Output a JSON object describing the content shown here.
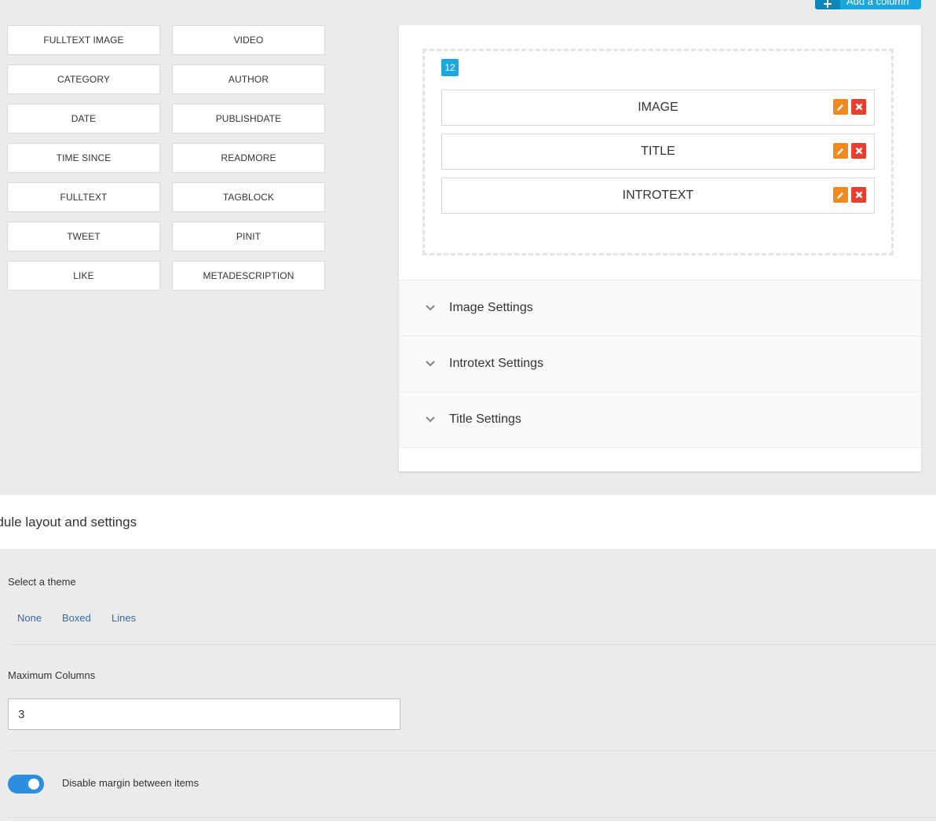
{
  "top": {
    "add_column_label": "Add a column"
  },
  "fields": [
    [
      "FULLTEXT IMAGE",
      "VIDEO"
    ],
    [
      "CATEGORY",
      "AUTHOR"
    ],
    [
      "DATE",
      "PUBLISHDATE"
    ],
    [
      "TIME SINCE",
      "READMORE"
    ],
    [
      "FULLTEXT",
      "TAGBLOCK"
    ],
    [
      "TWEET",
      "PINIT"
    ],
    [
      "LIKE",
      "METADESCRIPTION"
    ]
  ],
  "layout": {
    "column_size": "12",
    "items": [
      "IMAGE",
      "TITLE",
      "INTROTEXT"
    ],
    "accordion": [
      "Image Settings",
      "Introtext Settings",
      "Title Settings"
    ]
  },
  "settings": {
    "title": "odule layout and settings",
    "theme_label": "Select a theme",
    "themes": [
      "None",
      "Boxed",
      "Lines"
    ],
    "max_columns_label": "Maximum Columns",
    "max_columns_value": "3",
    "disable_margin_label": "Disable margin between items",
    "disable_margin_on": true
  },
  "colors": {
    "accent": "#1aa6df",
    "edit": "#f08a1c",
    "delete": "#e8402f",
    "toggle": "#2d8ee0",
    "link": "#3a6aa0"
  }
}
